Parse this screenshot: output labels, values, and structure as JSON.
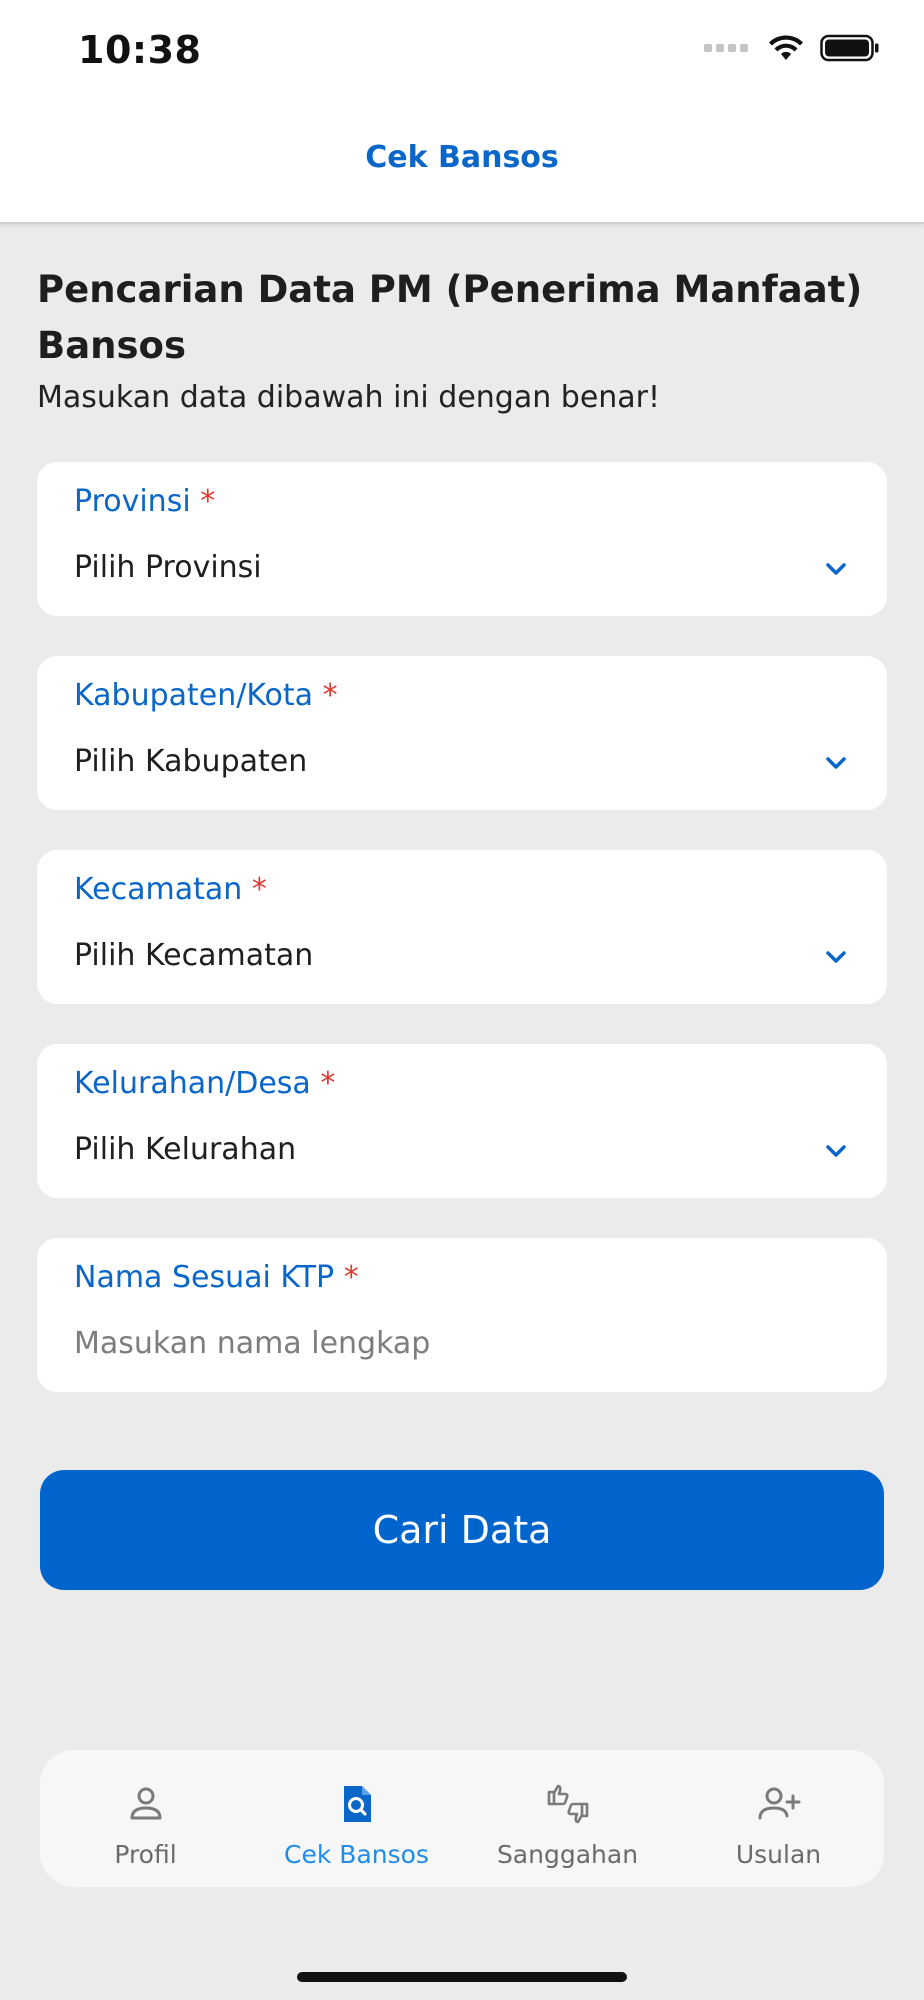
{
  "status_bar": {
    "time": "10:38"
  },
  "header": {
    "title": "Cek Bansos"
  },
  "main": {
    "heading": "Pencarian Data PM (Penerima Manfaat) Bansos",
    "subheading": "Masukan data dibawah ini dengan benar!",
    "required_marker": "*",
    "fields": [
      {
        "label": "Provinsi",
        "value": "Pilih Provinsi",
        "type": "select"
      },
      {
        "label": "Kabupaten/Kota",
        "value": "Pilih Kabupaten",
        "type": "select"
      },
      {
        "label": "Kecamatan",
        "value": "Pilih Kecamatan",
        "type": "select"
      },
      {
        "label": "Kelurahan/Desa",
        "value": "Pilih Kelurahan",
        "type": "select"
      },
      {
        "label": "Nama Sesuai KTP",
        "placeholder": "Masukan nama lengkap",
        "type": "text"
      }
    ],
    "submit_label": "Cari Data"
  },
  "tab_bar": {
    "items": [
      {
        "label": "Profil",
        "icon": "user-icon",
        "active": false
      },
      {
        "label": "Cek Bansos",
        "icon": "search-document-icon",
        "active": true
      },
      {
        "label": "Sanggahan",
        "icon": "thumbs-up-down-icon",
        "active": false
      },
      {
        "label": "Usulan",
        "icon": "add-user-icon",
        "active": false
      }
    ]
  },
  "colors": {
    "primary": "#0064cd",
    "accent_label": "#0a66c8",
    "required": "#e2382f",
    "active_tab": "#1e8ce8",
    "inactive_tab": "#6b6b6b",
    "background": "#ebebeb"
  }
}
